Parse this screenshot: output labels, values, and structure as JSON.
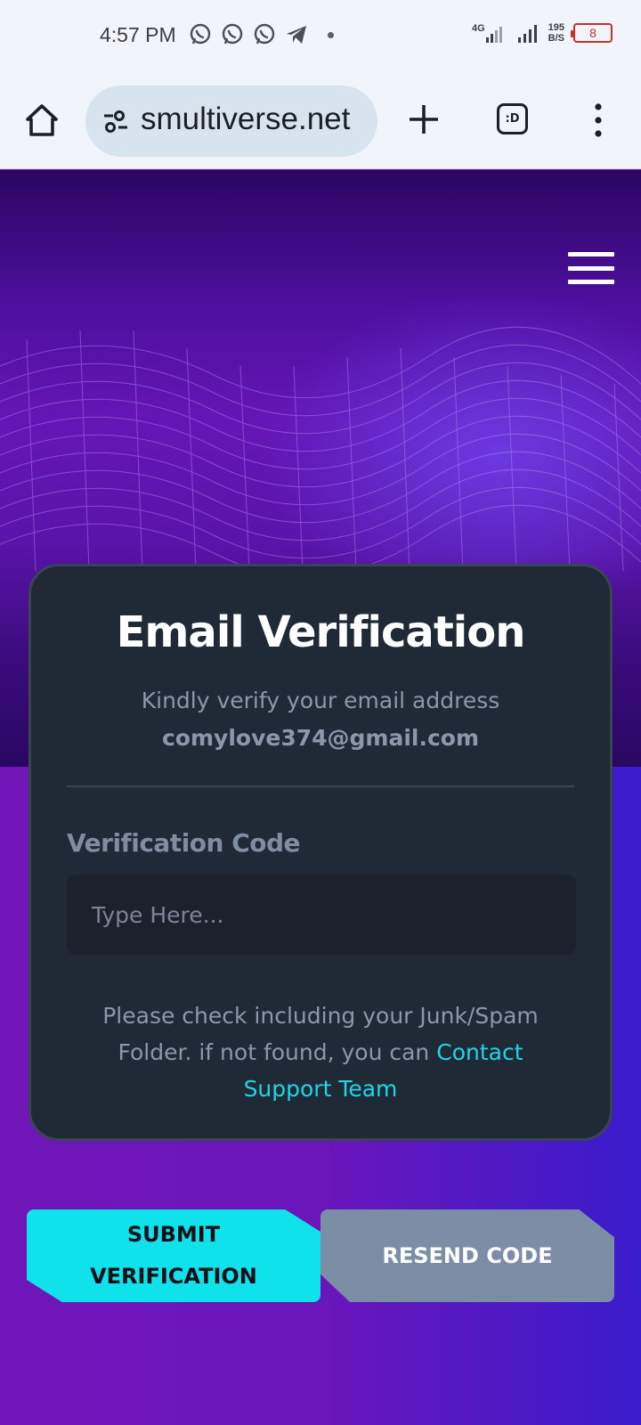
{
  "status_bar": {
    "time": "4:57 PM",
    "app_icons": [
      "whatsapp-icon",
      "whatsapp-icon",
      "whatsapp-icon",
      "telegram-icon"
    ],
    "network": "4G",
    "net_speed_value": "195",
    "net_speed_unit": "B/S",
    "battery": "8"
  },
  "browser": {
    "url": "smultiverse.net",
    "tabs_label": ":D"
  },
  "card": {
    "title": "Email Verification",
    "subtitle": "Kindly verify your email address",
    "email": "comylove374@gmail.com",
    "field_label": "Verification Code",
    "input_placeholder": "Type Here...",
    "input_value": "",
    "help_text": "Please check including your Junk/Spam Folder. if not found, you can",
    "help_link": "Contact Support Team"
  },
  "buttons": {
    "submit_line1": "SUBMIT",
    "submit_line2": "VERIFICATION",
    "resend": "RESEND CODE"
  },
  "colors": {
    "accent": "#0fe2ea",
    "link": "#1fd6e4",
    "card_bg": "#1f2a36",
    "secondary_button": "#7c8ea6",
    "battery_low": "#c9302c"
  }
}
